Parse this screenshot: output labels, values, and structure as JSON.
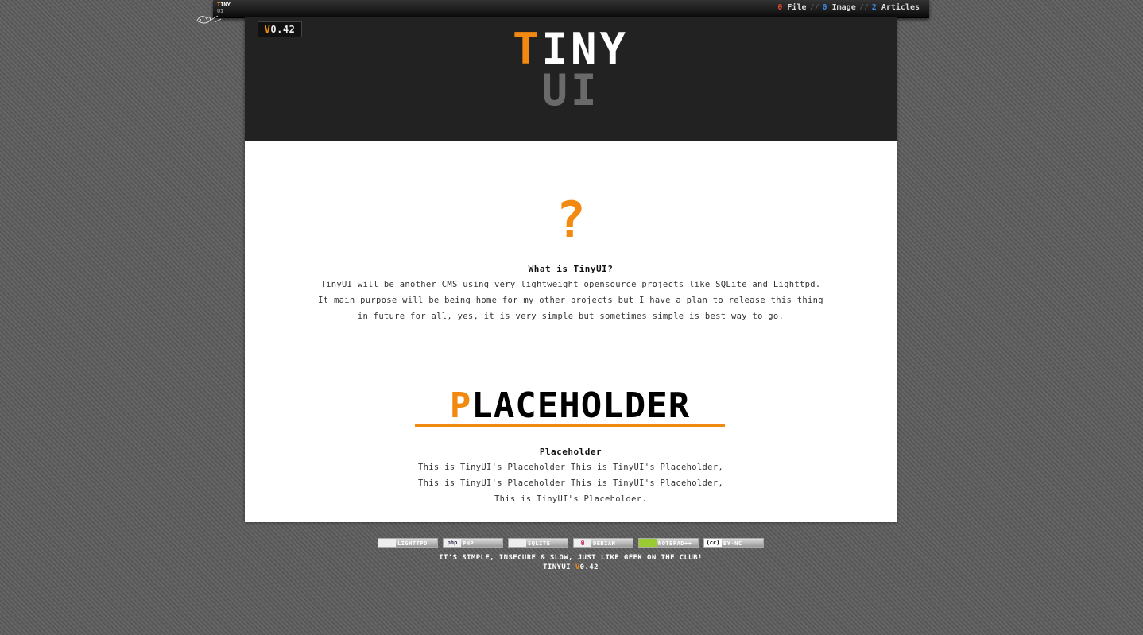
{
  "topbar": {
    "logo_line1_initial": "T",
    "logo_line1_rest": "INY",
    "logo_line2": "UI",
    "stats": [
      {
        "count": "0",
        "label": "File",
        "color": "#e84a2e"
      },
      {
        "count": "0",
        "label": "Image",
        "color": "#3f87e8"
      },
      {
        "count": "2",
        "label": "Articles",
        "color": "#3f87e8"
      }
    ],
    "separator": "//"
  },
  "header": {
    "version_prefix": "V",
    "version_number": "0.42",
    "logo_initial": "T",
    "logo_rest": "INY",
    "logo_line2": "UI"
  },
  "intro": {
    "icon_glyph": "?",
    "title": "What is TinyUI?",
    "lines": [
      "TinyUI will be another CMS using very lightweight opensource projects like SQLite and Lighttpd.",
      "It main purpose will be being home for my other projects but I have a plan to release this thing",
      "in future for all, yes, it is very simple but sometimes simple is best way to go."
    ]
  },
  "placeholder": {
    "banner_initial": "P",
    "banner_rest": "LACEHOLDER",
    "title": "Placeholder",
    "lines": [
      "This is TinyUI's Placeholder This is TinyUI's Placeholder,",
      "This is TinyUI's Placeholder This is TinyUI's Placeholder,",
      "This is TinyUI's Placeholder."
    ]
  },
  "footer": {
    "buttons": [
      {
        "icon": "feather-icon",
        "icon_text": "",
        "label": "LIGHTTPD"
      },
      {
        "icon": "php-icon",
        "icon_text": "php",
        "label": "PHP"
      },
      {
        "icon": "feather-icon",
        "icon_text": "",
        "label": "SQLITE"
      },
      {
        "icon": "debian-swirl-icon",
        "icon_text": "@",
        "label": "DEBIAN"
      },
      {
        "icon": "chameleon-icon",
        "icon_text": "",
        "label": "NOTEPAD++"
      },
      {
        "icon": "cc-icon",
        "icon_text": "(cc)",
        "label": "BY-NC"
      }
    ],
    "tagline": "IT'S SIMPLE, INSECURE & SLOW, JUST LIKE GEEK ON THE CLUB!",
    "version_label": "TINYUI",
    "version_prefix": "V",
    "version_number": "0.42"
  },
  "colors": {
    "accent": "#f28a12",
    "header_bg": "#222222",
    "page_bg": "#ffffff",
    "stat_red": "#e84a2e",
    "stat_blue": "#3f87e8"
  }
}
